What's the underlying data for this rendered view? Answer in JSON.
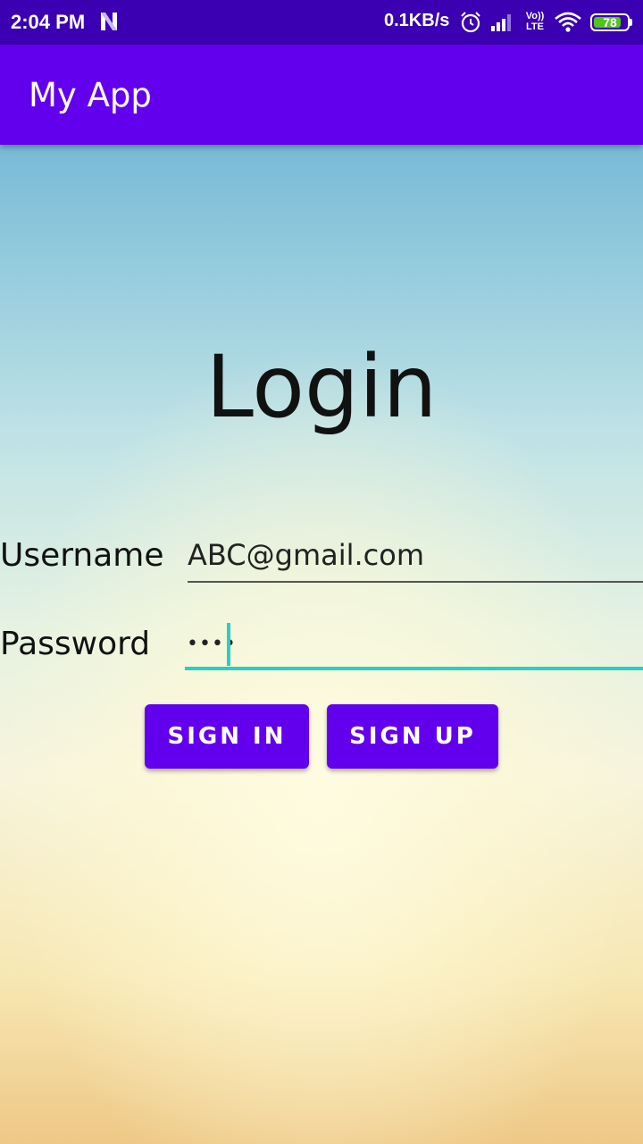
{
  "status_bar": {
    "time": "2:04 PM",
    "network_speed": "0.1KB/s",
    "volte_line1": "Vo))",
    "volte_line2": "LTE",
    "battery_level": "78",
    "icons": [
      "netflix-n-icon",
      "alarm-icon",
      "signal-icon",
      "volte-icon",
      "wifi-icon",
      "battery-icon"
    ]
  },
  "app_bar": {
    "title": "My App",
    "color": "#6200ee"
  },
  "login": {
    "title": "Login",
    "username_label": "Username",
    "username_value": "ABC@gmail.com",
    "password_label": "Password",
    "password_masked": "••••",
    "password_length": 4,
    "accent_color": "#26d0c4"
  },
  "buttons": {
    "sign_in": "SIGN IN",
    "sign_up": "SIGN UP",
    "color": "#6200ee"
  }
}
